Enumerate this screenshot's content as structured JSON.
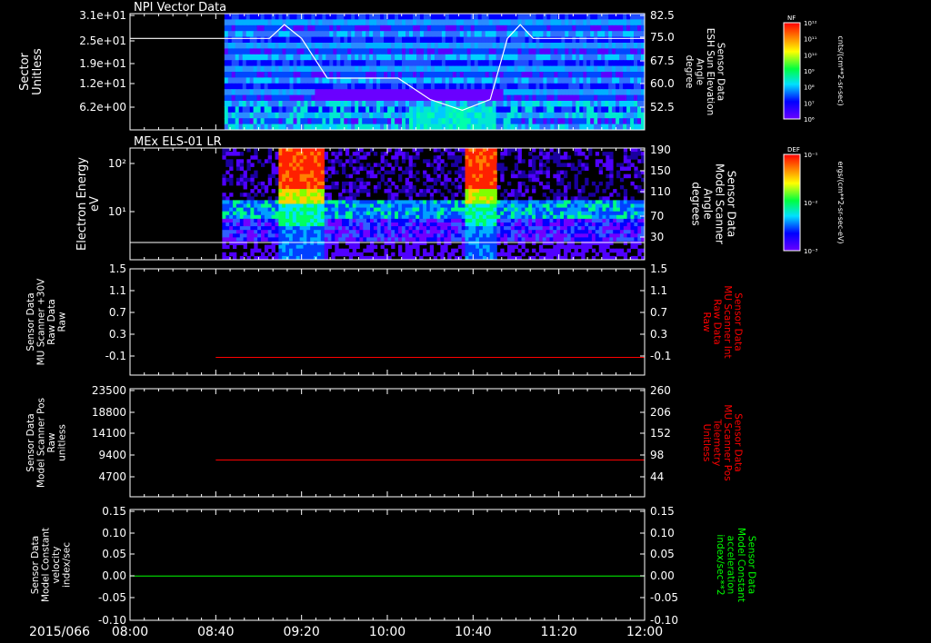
{
  "panels": [
    {
      "title": "NPI Vector Data",
      "left_label": [
        "Sector",
        "Unitless"
      ],
      "left_ticks": [
        "3.1e+01",
        "2.5e+01",
        "1.9e+01",
        "1.2e+01",
        "6.2e+00"
      ],
      "right_label": [
        "Sensor Data",
        "ESH Sun Elevation",
        "Angle",
        "degree"
      ],
      "right_ticks": [
        "82.5",
        "75.0",
        "67.5",
        "60.0",
        "52.5"
      ],
      "colorbar": {
        "tag": "NF",
        "units": "cnts/(cm**2-sr-sec)",
        "labels": [
          "10¹²",
          "10¹¹",
          "10¹⁰",
          "10⁹",
          "10⁸",
          "10⁷",
          "10⁶"
        ]
      }
    },
    {
      "title": "MEx ELS-01 LR",
      "left_label": [
        "Electron Energy",
        "eV"
      ],
      "left_ticks": [
        "10²",
        "10¹"
      ],
      "right_label": [
        "Sensor Data",
        "Model Scanner",
        "Angle",
        "degrees"
      ],
      "right_ticks": [
        "190",
        "150",
        "110",
        "70",
        "30"
      ],
      "colorbar": {
        "tag": "DEF",
        "units": "ergs/(cm**2-sr-sec-eV)",
        "labels": [
          "10⁻¹",
          "10⁻²",
          "10⁻³"
        ]
      }
    },
    {
      "left_label": [
        "Sensor Data",
        "MU Scanner +30V",
        "Raw Data",
        "Raw"
      ],
      "left_ticks": [
        "1.5",
        "1.1",
        "0.7",
        "0.3",
        "-0.1"
      ],
      "right_label": [
        "Sensor Data",
        "MU Scanner Int",
        "Raw Data",
        "Raw"
      ],
      "right_ticks": [
        "1.5",
        "1.1",
        "0.7",
        "0.3",
        "-0.1"
      ]
    },
    {
      "left_label": [
        "Sensor Data",
        "Model Scanner Pos",
        "Raw",
        "unitless"
      ],
      "left_ticks": [
        "23500",
        "18800",
        "14100",
        "9400",
        "4700"
      ],
      "right_label": [
        "Sensor Data",
        "MU Scanner Pos",
        "Telemetry",
        "Unitless"
      ],
      "right_ticks": [
        "260",
        "206",
        "152",
        "98",
        "44"
      ]
    },
    {
      "left_label": [
        "Sensor Data",
        "Model Constant",
        "velocity",
        "index/sec"
      ],
      "left_ticks": [
        "0.15",
        "0.10",
        "0.05",
        "0.00",
        "-0.05",
        "-0.10"
      ],
      "right_label": [
        "Sensor Data",
        "Model Constant",
        "acceleration",
        "index/sec**2"
      ],
      "right_ticks": [
        "0.15",
        "0.10",
        "0.05",
        "0.00",
        "-0.05",
        "-0.10"
      ]
    }
  ],
  "time_axis": {
    "date": "2015/066",
    "ticks": [
      "08:00",
      "08:40",
      "09:20",
      "10:00",
      "10:40",
      "11:20",
      "12:00"
    ]
  },
  "colors": {
    "background": "#000000",
    "axes": "#ffffff",
    "red_trace": "#ff0000",
    "green_trace": "#00ff00",
    "right_label_red": "#ff0000",
    "right_label_green": "#00ff00"
  },
  "chart_data": [
    {
      "type": "heatmap",
      "title": "NPI Vector Data",
      "ylabel": "Sector Unitless",
      "y2label": "Sensor Data ESH Sun Elevation Angle degree",
      "x": [
        "08:00",
        "12:00"
      ],
      "data_start": "08:44",
      "overlay_line": {
        "axis": "right",
        "points": [
          [
            "08:00",
            75.0
          ],
          [
            "09:05",
            75.0
          ],
          [
            "09:12",
            79.5
          ],
          [
            "09:20",
            75.0
          ],
          [
            "09:32",
            62.0
          ],
          [
            "10:05",
            62.0
          ],
          [
            "10:20",
            55.0
          ],
          [
            "10:35",
            51.5
          ],
          [
            "10:48",
            55.0
          ],
          [
            "10:56",
            75.0
          ],
          [
            "11:02",
            79.5
          ],
          [
            "11:08",
            75.0
          ],
          [
            "12:00",
            75.0
          ]
        ]
      }
    },
    {
      "type": "heatmap",
      "title": "MEx ELS-01 LR",
      "ylabel": "Electron Energy eV",
      "yscale": "log",
      "y2label": "Sensor Data Model Scanner Angle degrees",
      "x": [
        "08:00",
        "12:00"
      ],
      "data_start": "08:43",
      "enhancements": [
        [
          "09:08",
          "09:30"
        ],
        [
          "10:35",
          "10:50"
        ]
      ],
      "overlay_line": {
        "axis": "right",
        "value": 20
      }
    },
    {
      "type": "line",
      "ylabel": "Sensor Data MU Scanner +30V Raw Data Raw",
      "y2label": "Sensor Data MU Scanner Int Raw Data Raw",
      "ylim": [
        -0.3,
        1.5
      ],
      "series": [
        {
          "x": [
            "08:40",
            "12:00"
          ],
          "values": [
            0.0,
            0.0
          ]
        }
      ]
    },
    {
      "type": "line",
      "ylabel": "Sensor Data Model Scanner Pos Raw unitless",
      "y2label": "Sensor Data MU Scanner Pos Telemetry Unitless",
      "ylim": [
        0,
        23500
      ],
      "series": [
        {
          "x": [
            "08:40",
            "12:00"
          ],
          "values": [
            8000,
            8000
          ]
        }
      ]
    },
    {
      "type": "line",
      "ylabel": "Sensor Data Model Constant velocity index/sec",
      "y2label": "Sensor Data Model Constant acceleration index/sec**2",
      "ylim": [
        -0.1,
        0.15
      ],
      "series": [
        {
          "x": [
            "08:00",
            "12:00"
          ],
          "values": [
            0.0,
            0.0
          ]
        }
      ]
    }
  ]
}
